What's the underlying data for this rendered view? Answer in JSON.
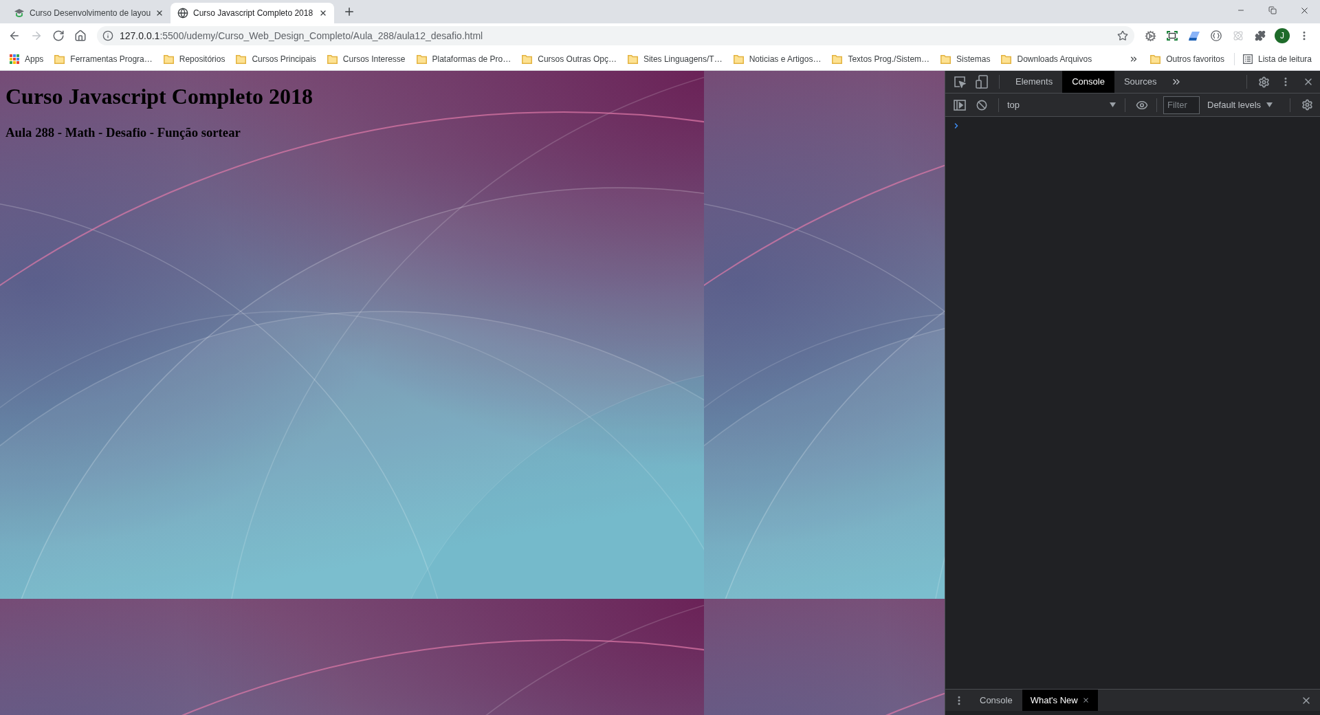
{
  "browser": {
    "tabs": [
      {
        "title": "Curso Desenvolvimento de layou",
        "kind": "site",
        "selected": false
      },
      {
        "title": "Curso Javascript Completo 2018",
        "kind": "local",
        "selected": true
      }
    ],
    "navigation": [
      {
        "kind": "back",
        "disabled": false
      },
      {
        "kind": "forward",
        "disabled": true
      },
      {
        "kind": "reload",
        "disabled": false
      },
      {
        "kind": "home",
        "disabled": false
      }
    ],
    "address": {
      "host": "127.0.0.1",
      "path": ":5500/udemy/Curso_Web_Design_Completo/Aula_288/aula12_desafio.html",
      "bookmarked": false
    },
    "profile": {
      "initial": "J"
    },
    "bookmarks": [
      {
        "label": "Apps",
        "kind": "apps"
      },
      {
        "label": "Ferramentas Progra…",
        "kind": "folder"
      },
      {
        "label": "Repositórios",
        "kind": "folder"
      },
      {
        "label": "Cursos Principais",
        "kind": "folder"
      },
      {
        "label": "Cursos Interesse",
        "kind": "folder"
      },
      {
        "label": "Plataformas de Pro…",
        "kind": "folder"
      },
      {
        "label": "Cursos Outras Opç…",
        "kind": "folder"
      },
      {
        "label": "Sites Linguagens/T…",
        "kind": "folder"
      },
      {
        "label": "Noticias e Artigos…",
        "kind": "folder"
      },
      {
        "label": "Textos Prog./Sistem…",
        "kind": "folder"
      },
      {
        "label": "Sistemas",
        "kind": "folder"
      },
      {
        "label": "Downloads Arquivos",
        "kind": "folder"
      }
    ],
    "other_bookmarks": "Outros favoritos",
    "reading_list": "Lista de leitura"
  },
  "page": {
    "title": "Curso Javascript Completo 2018",
    "subtitle": "Aula 288 - Math - Desafio - Função sortear"
  },
  "devtools": {
    "tabs": [
      {
        "label": "Elements",
        "selected": false
      },
      {
        "label": "Console",
        "selected": true
      },
      {
        "label": "Sources",
        "selected": false
      }
    ],
    "context": "top",
    "filter": {
      "placeholder": "Filter"
    },
    "levels": "Default levels",
    "drawer_tabs": [
      {
        "label": "Console",
        "selected": false,
        "closable": false
      },
      {
        "label": "What's New",
        "selected": true,
        "closable": true
      }
    ]
  }
}
